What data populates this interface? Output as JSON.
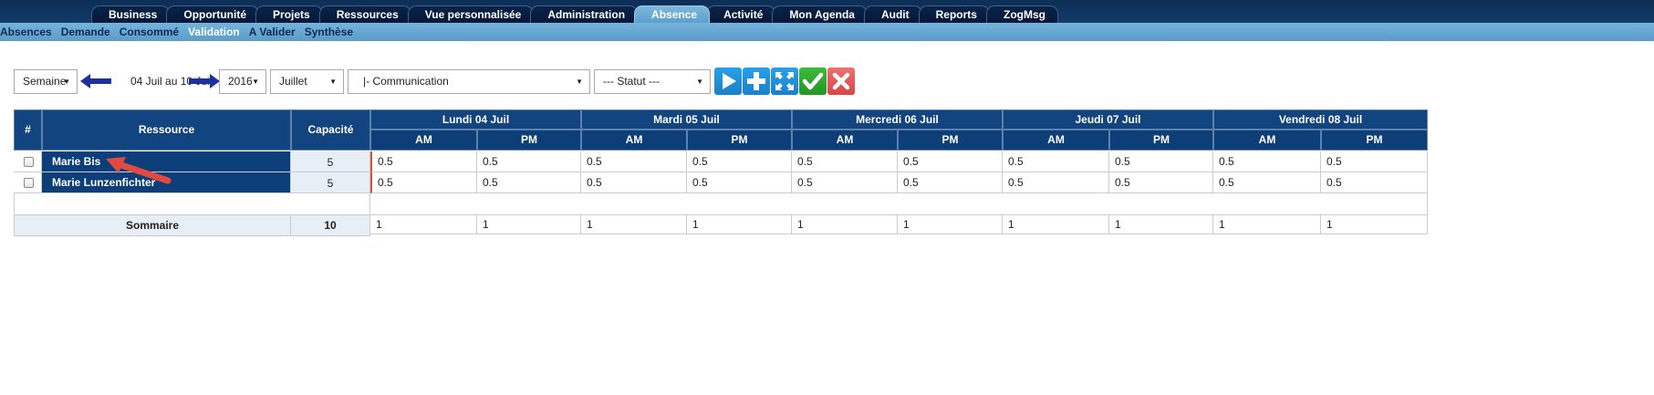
{
  "top_tabs": [
    {
      "label": "Business"
    },
    {
      "label": "Opportunité"
    },
    {
      "label": "Projets"
    },
    {
      "label": "Ressources"
    },
    {
      "label": "Vue personnalisée"
    },
    {
      "label": "Administration"
    },
    {
      "label": "Absence",
      "active": true
    },
    {
      "label": "Activité"
    },
    {
      "label": "Mon Agenda"
    },
    {
      "label": "Audit"
    },
    {
      "label": "Reports"
    },
    {
      "label": "ZogMsg"
    }
  ],
  "sub_menu": [
    {
      "label": "Absences"
    },
    {
      "label": "Demande"
    },
    {
      "label": "Consommé"
    },
    {
      "label": "Validation",
      "active": true
    },
    {
      "label": "A Valider"
    },
    {
      "label": "Synthèse"
    }
  ],
  "toolbar": {
    "period_select": "Semaine",
    "date_range": "04 Juil au 10 Juil",
    "year_select": "2016",
    "month_select": "Juillet",
    "team_select": "|- Communication",
    "status_select": "--- Statut ---",
    "icons": [
      "play-icon",
      "plus-icon",
      "expand-icon",
      "check-icon",
      "close-icon"
    ],
    "colors": {
      "blue_button": "#1a8fdc",
      "green_button": "#2fa82f",
      "red_button": "#e05555",
      "arrow": "#1f2f9c"
    }
  },
  "grid": {
    "headers": {
      "hash": "#",
      "resource": "Ressource",
      "capacity": "Capacité"
    },
    "days": [
      "Lundi 04 Juil",
      "Mardi 05 Juil",
      "Mercredi 06 Juil",
      "Jeudi 07 Juil",
      "Vendredi 08 Juil"
    ],
    "am_label": "AM",
    "pm_label": "PM",
    "rows": [
      {
        "name": "Marie Bis",
        "capacity": "5",
        "values": [
          "0.5",
          "0.5",
          "0.5",
          "0.5",
          "0.5",
          "0.5",
          "0.5",
          "0.5",
          "0.5",
          "0.5"
        ]
      },
      {
        "name": "Marie Lunzenfichter",
        "capacity": "5",
        "values": [
          "0.5",
          "0.5",
          "0.5",
          "0.5",
          "0.5",
          "0.5",
          "0.5",
          "0.5",
          "0.5",
          "0.5"
        ]
      }
    ],
    "summary": {
      "label": "Sommaire",
      "capacity": "10",
      "values": [
        "1",
        "1",
        "1",
        "1",
        "1",
        "1",
        "1",
        "1",
        "1",
        "1"
      ]
    },
    "colors": {
      "header_bg": "#12447f",
      "resource_bg": "#0c3f7a",
      "capacity_bg": "#e8eef6",
      "annotation_arrow": "#e04a3f"
    }
  }
}
